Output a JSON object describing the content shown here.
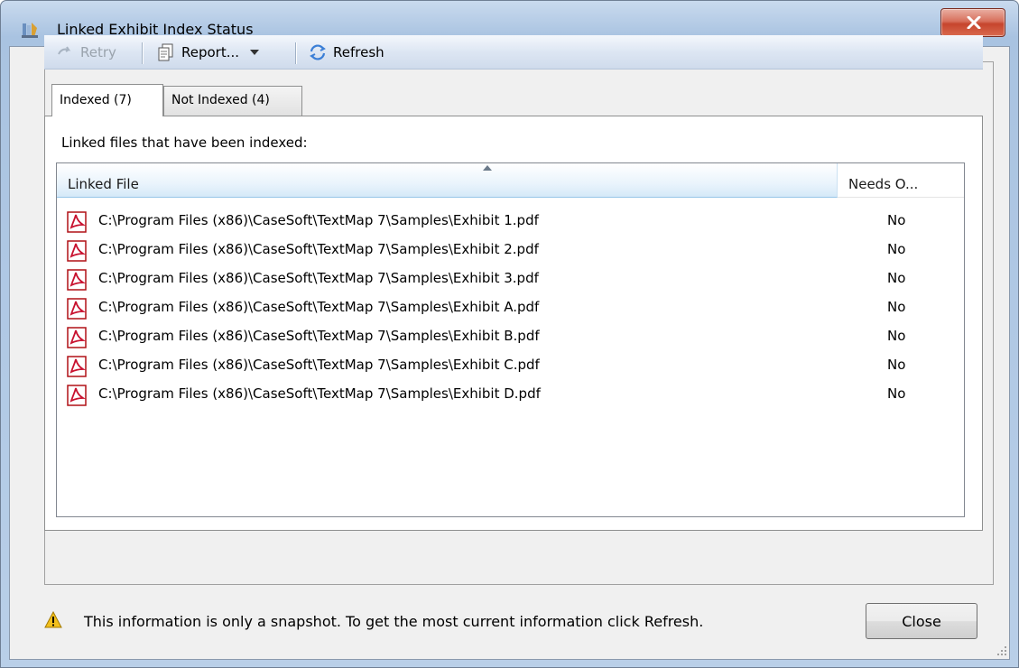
{
  "window": {
    "title": "Linked Exhibit Index Status",
    "app_icon": "textmap-app-icon",
    "close_icon": "close-x-icon"
  },
  "toolbar": {
    "retry_label": "Retry",
    "report_label": "Report...",
    "refresh_label": "Refresh"
  },
  "tabs": [
    {
      "label": "Indexed (7)",
      "active": true
    },
    {
      "label": "Not Indexed (4)",
      "active": false
    }
  ],
  "panel": {
    "label": "Linked files that have been indexed:"
  },
  "table": {
    "columns": [
      "Linked File",
      "Needs O..."
    ],
    "rows": [
      {
        "file": "C:\\Program Files (x86)\\CaseSoft\\TextMap 7\\Samples\\Exhibit 1.pdf",
        "needs": "No",
        "icon": "pdf-icon"
      },
      {
        "file": "C:\\Program Files (x86)\\CaseSoft\\TextMap 7\\Samples\\Exhibit 2.pdf",
        "needs": "No",
        "icon": "pdf-icon"
      },
      {
        "file": "C:\\Program Files (x86)\\CaseSoft\\TextMap 7\\Samples\\Exhibit 3.pdf",
        "needs": "No",
        "icon": "pdf-icon"
      },
      {
        "file": "C:\\Program Files (x86)\\CaseSoft\\TextMap 7\\Samples\\Exhibit A.pdf",
        "needs": "No",
        "icon": "pdf-icon"
      },
      {
        "file": "C:\\Program Files (x86)\\CaseSoft\\TextMap 7\\Samples\\Exhibit B.pdf",
        "needs": "No",
        "icon": "pdf-icon"
      },
      {
        "file": "C:\\Program Files (x86)\\CaseSoft\\TextMap 7\\Samples\\Exhibit C.pdf",
        "needs": "No",
        "icon": "pdf-icon"
      },
      {
        "file": "C:\\Program Files (x86)\\CaseSoft\\TextMap 7\\Samples\\Exhibit D.pdf",
        "needs": "No",
        "icon": "pdf-icon"
      }
    ]
  },
  "footer": {
    "message": "This information is only a snapshot.  To get the most current information click Refresh.",
    "close_label": "Close",
    "warning_icon": "warning-icon"
  },
  "colors": {
    "accent": "#3399ff",
    "pdf_red": "#c8102e",
    "titlebar": "#a9c3e1",
    "close_red": "#c6452d"
  }
}
